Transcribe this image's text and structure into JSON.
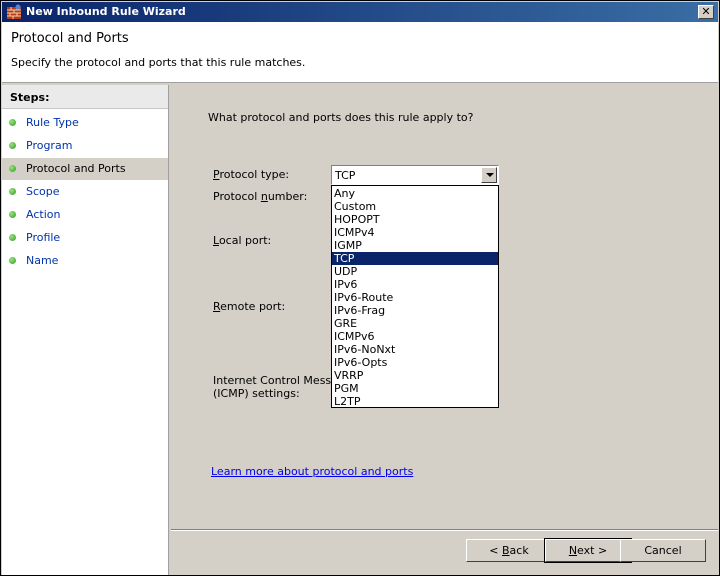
{
  "window": {
    "title": "New Inbound Rule Wizard",
    "close_glyph": "✕"
  },
  "header": {
    "title": "Protocol and Ports",
    "subtitle": "Specify the protocol and ports that this rule matches."
  },
  "steps": {
    "title": "Steps:",
    "items": [
      {
        "label": "Rule Type",
        "active": false
      },
      {
        "label": "Program",
        "active": false
      },
      {
        "label": "Protocol and Ports",
        "active": true
      },
      {
        "label": "Scope",
        "active": false
      },
      {
        "label": "Action",
        "active": false
      },
      {
        "label": "Profile",
        "active": false
      },
      {
        "label": "Name",
        "active": false
      }
    ]
  },
  "main": {
    "question": "What protocol and ports does this rule apply to?",
    "protocol_type_label_pre": "",
    "protocol_type_label_u": "P",
    "protocol_type_label_post": "rotocol type:",
    "protocol_number_label_pre": "Protocol ",
    "protocol_number_label_u": "n",
    "protocol_number_label_post": "umber:",
    "local_port_label_pre": "",
    "local_port_label_u": "L",
    "local_port_label_post": "ocal port:",
    "remote_port_label_pre": "",
    "remote_port_label_u": "R",
    "remote_port_label_post": "emote port:",
    "icmp_label_line1": "Internet Control Message",
    "icmp_label_line2": "(ICMP) settings:",
    "protocol_selected": "TCP",
    "protocol_options": [
      "Any",
      "Custom",
      "HOPOPT",
      "ICMPv4",
      "IGMP",
      "TCP",
      "UDP",
      "IPv6",
      "IPv6-Route",
      "IPv6-Frag",
      "GRE",
      "ICMPv6",
      "IPv6-NoNxt",
      "IPv6-Opts",
      "VRRP",
      "PGM",
      "L2TP"
    ],
    "learn_more_link": "Learn more about protocol and ports"
  },
  "buttons": {
    "back_pre": "< ",
    "back_u": "B",
    "back_post": "ack",
    "next_u": "N",
    "next_post": "ext >",
    "cancel": "Cancel"
  },
  "icons": {
    "app_icon": "firewall-wall-icon",
    "step_icon": "green-dot-icon",
    "dropdown_icon": "chevron-down-icon"
  },
  "colors": {
    "titlebar": "#0a246a",
    "selection": "#0a246a",
    "link": "#0033aa",
    "step_dot": "#2f9a22"
  }
}
